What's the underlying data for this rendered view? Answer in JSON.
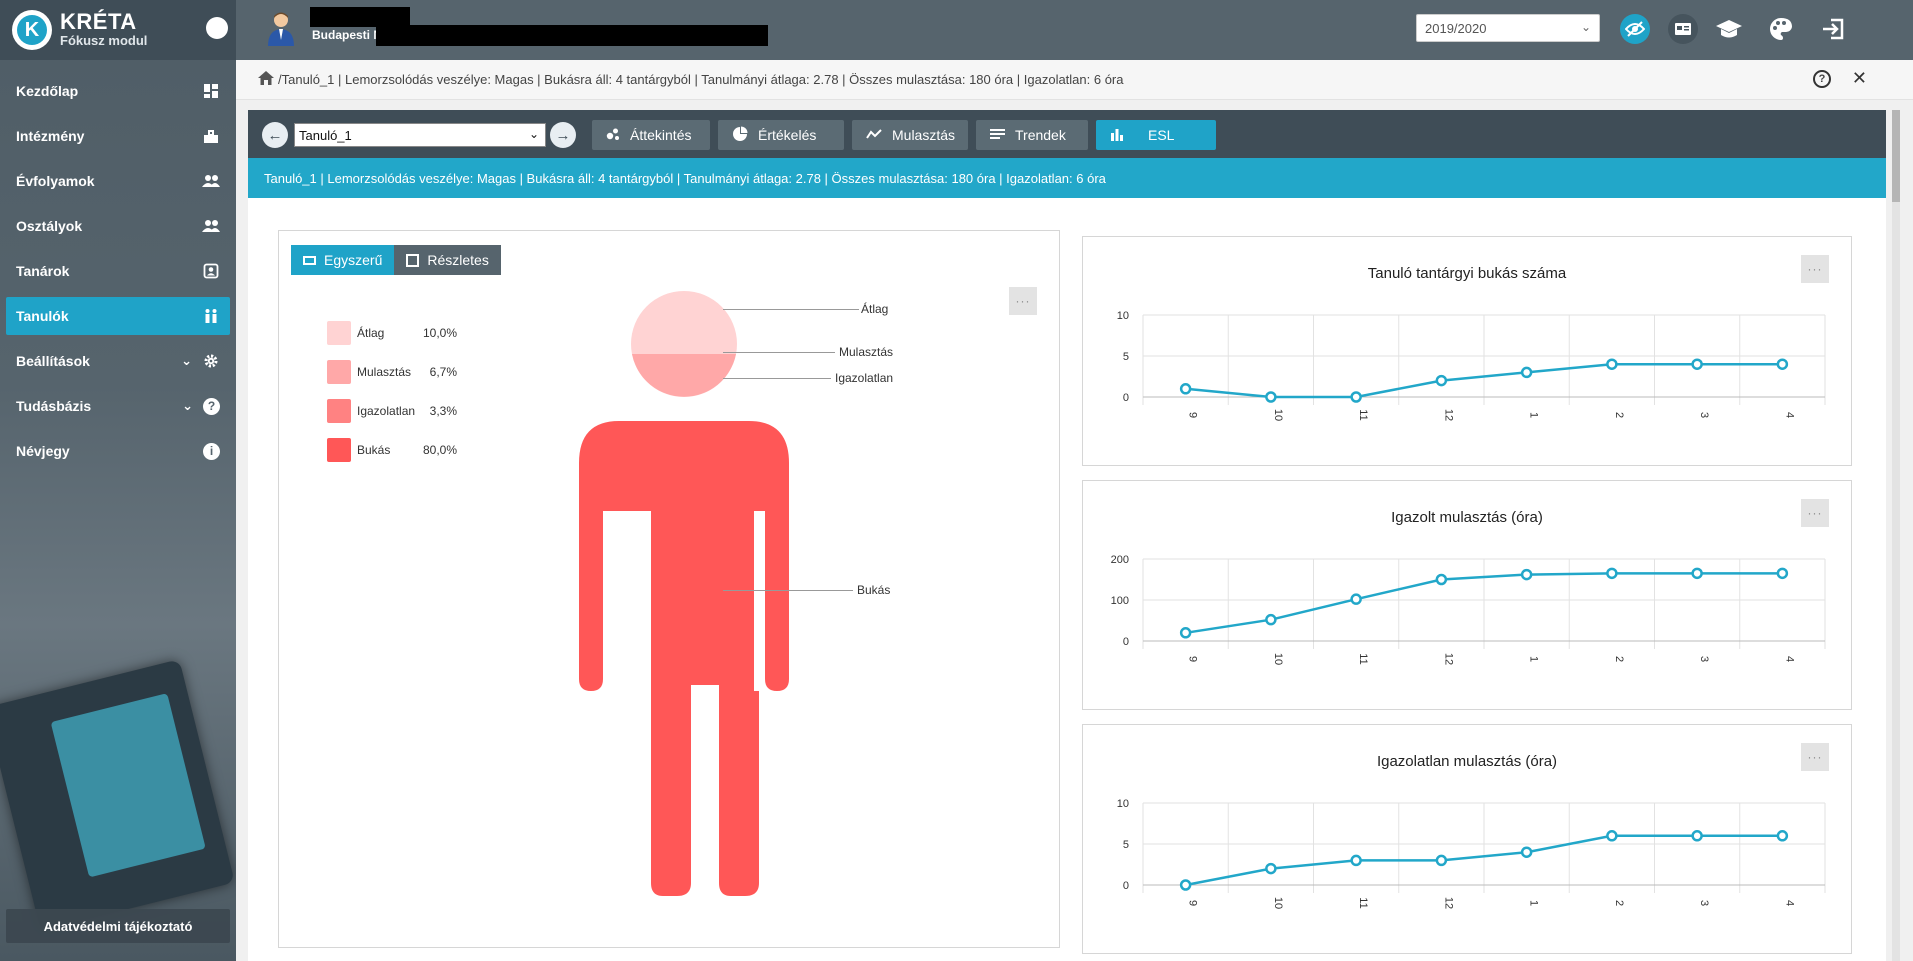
{
  "sidebar": {
    "logo_letter": "K",
    "logo_title": "KRÉTA",
    "logo_subtitle": "Fókusz modul",
    "items": [
      {
        "label": "Kezdőlap",
        "icon": "dashboard-icon"
      },
      {
        "label": "Intézmény",
        "icon": "building-icon"
      },
      {
        "label": "Évfolyamok",
        "icon": "users-icon"
      },
      {
        "label": "Osztályok",
        "icon": "users-icon"
      },
      {
        "label": "Tanárok",
        "icon": "id-card-icon"
      },
      {
        "label": "Tanulók",
        "icon": "students-icon"
      },
      {
        "label": "Beállítások",
        "icon": "gear-icon"
      },
      {
        "label": "Tudásbázis",
        "icon": "help-icon"
      },
      {
        "label": "Névjegy",
        "icon": "info-icon"
      }
    ],
    "active_index": 5,
    "privacy_label": "Adatvédelmi tájékoztató",
    "help_glyph": "?",
    "info_glyph": "i"
  },
  "topbar": {
    "institution": "Budapesti M",
    "school_year": "2019/2020"
  },
  "breadcrumb": {
    "text": "/Tanuló_1 | Lemorzsolódás veszélye: Magas | Bukásra áll: 4 tantárgyból | Tanulmányi átlaga: 2.78 | Összes mulasztása: 180 óra | Igazolatlan: 6 óra",
    "help_glyph": "?",
    "close_glyph": "✕"
  },
  "toolbar": {
    "student": "Tanuló_1",
    "prev_glyph": "←",
    "next_glyph": "→",
    "tabs": [
      "Áttekintés",
      "Értékelés",
      "Mulasztás",
      "Trendek",
      "ESL"
    ],
    "active_tab": 4
  },
  "infobar": {
    "text": "Tanuló_1 | Lemorzsolódás veszélye: Magas | Bukásra áll: 4 tantárgyból | Tanulmányi átlaga: 2.78 | Összes mulasztása: 180 óra | Igazolatlan: 6 óra"
  },
  "esl": {
    "view_simple": "Egyszerű",
    "view_detailed": "Részletes",
    "more_label": "···",
    "legend": [
      {
        "label": "Átlag",
        "value": "10,0%",
        "color": "#ffd3d3"
      },
      {
        "label": "Mulasztás",
        "value": "6,7%",
        "color": "#ffa8a8"
      },
      {
        "label": "Igazolatlan",
        "value": "3,3%",
        "color": "#ff8282"
      },
      {
        "label": "Bukás",
        "value": "80,0%",
        "color": "#ff5757"
      }
    ],
    "callouts": [
      "Átlag",
      "Mulasztás",
      "Igazolatlan",
      "Bukás"
    ]
  },
  "chart_data": [
    {
      "type": "line",
      "title": "Tanuló tantárgyi bukás száma",
      "categories": [
        "9",
        "10",
        "11",
        "12",
        "1",
        "2",
        "3",
        "4"
      ],
      "values": [
        1,
        0,
        0,
        2,
        3,
        4,
        4,
        4
      ],
      "ylim": [
        0,
        10
      ],
      "yticks": [
        0,
        5,
        10
      ],
      "color": "#22a7c9"
    },
    {
      "type": "line",
      "title": "Igazolt mulasztás (óra)",
      "categories": [
        "9",
        "10",
        "11",
        "12",
        "1",
        "2",
        "3",
        "4"
      ],
      "values": [
        20,
        52,
        102,
        150,
        162,
        165,
        165,
        165
      ],
      "ylim": [
        0,
        200
      ],
      "yticks": [
        0,
        100,
        200
      ],
      "color": "#22a7c9"
    },
    {
      "type": "line",
      "title": "Igazolatlan mulasztás (óra)",
      "categories": [
        "9",
        "10",
        "11",
        "12",
        "1",
        "2",
        "3",
        "4"
      ],
      "values": [
        0,
        2,
        3,
        3,
        4,
        6,
        6,
        6
      ],
      "ylim": [
        0,
        10
      ],
      "yticks": [
        0,
        5,
        10
      ],
      "color": "#22a7c9"
    }
  ]
}
